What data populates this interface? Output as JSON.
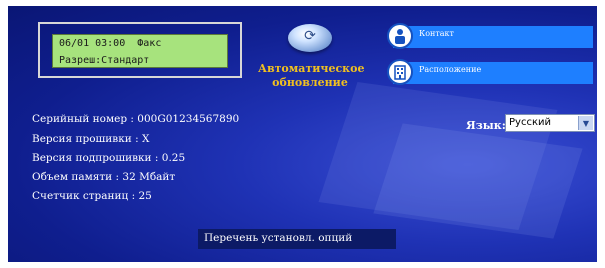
{
  "lcd": {
    "line1": "06/01 03:00  Факс",
    "line2": "Разреш:Стандарт"
  },
  "auto_update": {
    "label_line1": "Автоматическое",
    "label_line2": "обновление",
    "icon": "globe-refresh-icon"
  },
  "links": [
    {
      "label": "Контакт",
      "icon": "contact-person-icon"
    },
    {
      "label": "Расположение",
      "icon": "location-building-icon"
    }
  ],
  "language": {
    "label": "Язык:",
    "selected": "Русский"
  },
  "device_info": [
    "Серийный номер : 000G01234567890",
    "Версия прошивки : X",
    "Версия подпрошивки : 0.25",
    "Объем памяти : 32 Мбайт",
    "Счетчик страниц : 25"
  ],
  "options_link": "Перечень установл. опций",
  "colors": {
    "background": "#0f1e8e",
    "lcd": "#a7e37d",
    "accent_yellow": "#f0c020",
    "link_bar": "#1e7fff"
  }
}
